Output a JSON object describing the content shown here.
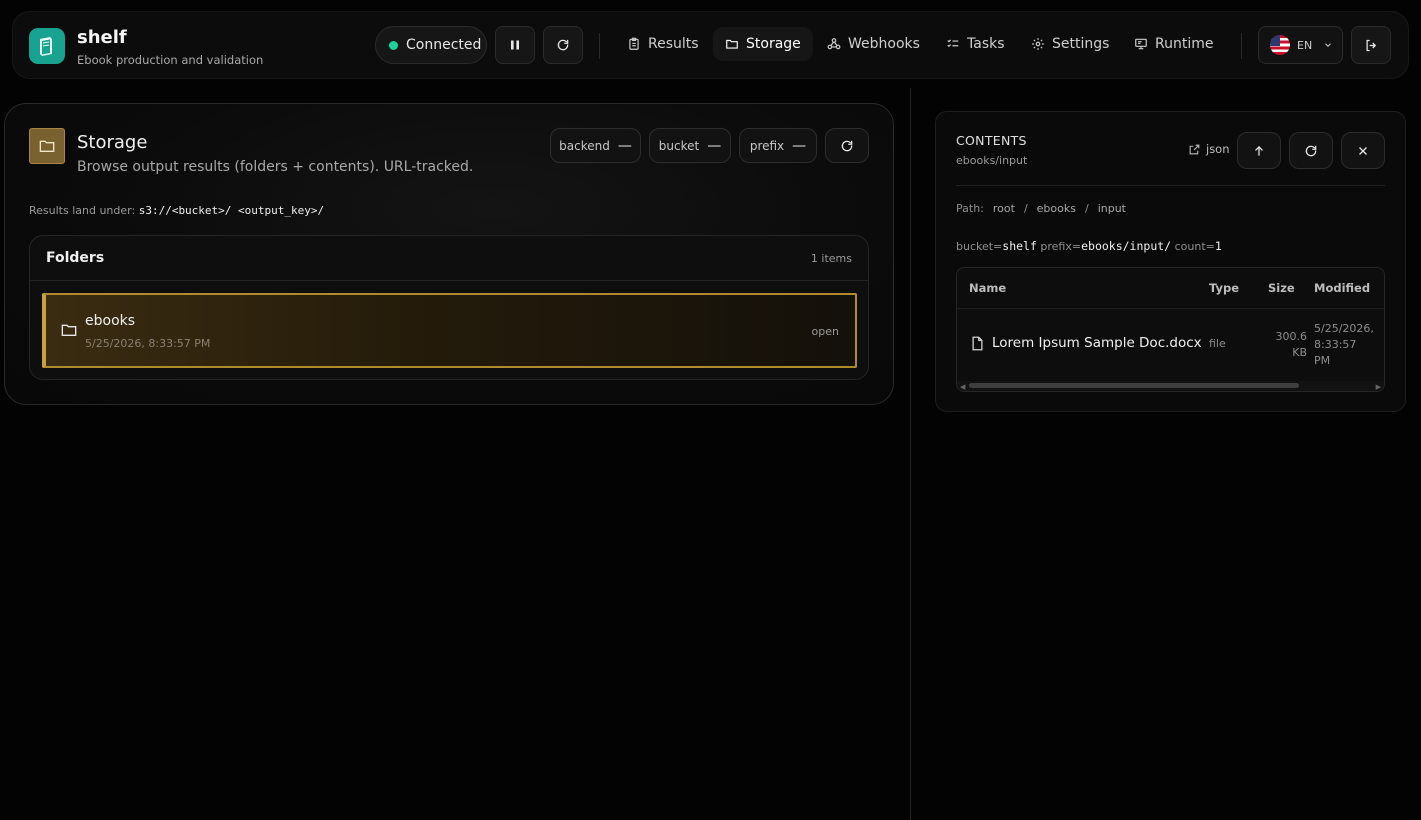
{
  "brand": {
    "title": "shelf",
    "subtitle": "Ebook production and validation"
  },
  "status": {
    "label": "Connected",
    "color": "#19d39b"
  },
  "nav": [
    {
      "label": "Results",
      "icon": "clipboard-icon"
    },
    {
      "label": "Storage",
      "icon": "folder-icon",
      "active": true
    },
    {
      "label": "Webhooks",
      "icon": "webhook-icon"
    },
    {
      "label": "Tasks",
      "icon": "list-checks-icon"
    },
    {
      "label": "Settings",
      "icon": "gear-icon"
    },
    {
      "label": "Runtime",
      "icon": "monitor-icon"
    }
  ],
  "language": {
    "code": "EN"
  },
  "storage": {
    "title": "Storage",
    "subtitle": "Browse output results (folders + contents). URL-tracked.",
    "chips": [
      {
        "label": "backend",
        "value": "—"
      },
      {
        "label": "bucket",
        "value": "—"
      },
      {
        "label": "prefix",
        "value": "—"
      }
    ],
    "land_label": "Results land under:",
    "land_path": "s3://<bucket>/ <output_key>/",
    "folders": {
      "title": "Folders",
      "count": "1 items",
      "items": [
        {
          "name": "ebooks",
          "date": "5/25/2026, 8:33:57 PM",
          "action": "open"
        }
      ]
    }
  },
  "contents": {
    "title": "CONTENTS",
    "subtitle": "ebooks/input",
    "json_label": "json",
    "path_label": "Path:",
    "path": [
      "root",
      "/",
      "ebooks",
      "/",
      "input"
    ],
    "meta": {
      "bucket_key": "bucket=",
      "bucket": "shelf",
      "prefix_key": "prefix=",
      "prefix": "ebooks/input/",
      "count_key": "count=",
      "count": "1"
    },
    "columns": [
      "Name",
      "Type",
      "Size",
      "Modified"
    ],
    "rows": [
      {
        "name": "Lorem Ipsum Sample Doc.docx",
        "type": "file",
        "size_a": "300.6",
        "size_b": "KB",
        "mod_a": "5/25/2026,",
        "mod_b": "8:33:57",
        "mod_c": "PM"
      }
    ]
  },
  "colors": {
    "accent": "#c9a13c",
    "brand": "#17a38f",
    "status": "#19d39b"
  }
}
